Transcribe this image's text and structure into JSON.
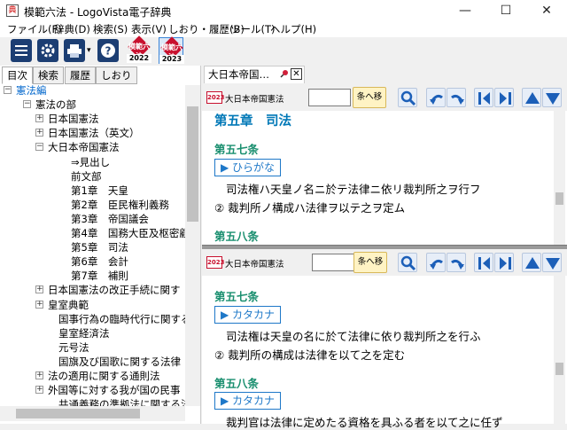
{
  "window": {
    "title": "模範六法 - LogoVista電子辞典",
    "app_icon_glyph": "典",
    "minimize_glyph": "—",
    "maximize_glyph": "☐",
    "close_glyph": "✕"
  },
  "menu": [
    "ファイル(F)",
    "辞典(D)",
    "検索(S)",
    "表示(V)",
    "しおり・履歴(B)",
    "ツール(T)",
    "ヘルプ(H)"
  ],
  "toolbar": {
    "books": [
      {
        "label": "模範六法",
        "year": "2022"
      },
      {
        "label": "模範六法",
        "year": "2023"
      }
    ],
    "dropdown_glyph": "▾"
  },
  "left_tabs": [
    "目次",
    "検索",
    "履歴",
    "しおり"
  ],
  "tree": [
    {
      "label": "憲法編",
      "exp": "⊟",
      "sel": true
    },
    {
      "label": "憲法の部",
      "exp": "⊟"
    },
    {
      "label": "日本国憲法",
      "exp": "⊞"
    },
    {
      "label": "日本国憲法（英文）",
      "exp": "⊞"
    },
    {
      "label": "大日本帝国憲法",
      "exp": "⊟"
    },
    {
      "label": "⇒見出し"
    },
    {
      "label": "前文部"
    },
    {
      "label": "第1章　天皇"
    },
    {
      "label": "第2章　臣民権利義務"
    },
    {
      "label": "第3章　帝国議会"
    },
    {
      "label": "第4章　国務大臣及枢密顧"
    },
    {
      "label": "第5章　司法"
    },
    {
      "label": "第6章　会計"
    },
    {
      "label": "第7章　補則"
    },
    {
      "label": "日本国憲法の改正手続に関す",
      "exp": "⊞"
    },
    {
      "label": "皇室典範",
      "exp": "⊞"
    },
    {
      "label": "国事行為の臨時代行に関する"
    },
    {
      "label": "皇室経済法"
    },
    {
      "label": "元号法"
    },
    {
      "label": "国旗及び国歌に関する法律"
    },
    {
      "label": "法の適用に関する通則法",
      "exp": "⊞"
    },
    {
      "label": "外国等に対する我が国の民事",
      "exp": "⊞"
    },
    {
      "label": "共通義務の準拠法に関する法"
    }
  ],
  "doc_tab": {
    "label": "大日本帝国…"
  },
  "dict_bar": {
    "logo": "2023",
    "name": "大日本帝国憲法",
    "go_label": "条へ移動",
    "search_value": ""
  },
  "top_pane": {
    "chapter": "第五章　司法",
    "article1": "第五七条",
    "kana_btn": "▶ ひらがな",
    "line1": "司法権ハ天皇ノ名ニ於テ法律ニ依リ裁判所之ヲ行フ",
    "line2": "②  裁判所ノ構成ハ法律ヲ以テ之ヲ定ム",
    "article2": "第五八条"
  },
  "bottom_pane": {
    "article1": "第五七条",
    "kana_btn": "▶ カタカナ",
    "line1": "司法権は天皇の名に於て法律に依り裁判所之を行ふ",
    "line2": "②  裁判所の構成は法律を以て之を定む",
    "article2": "第五八条",
    "kana_btn2": "▶ カタカナ",
    "line3": "裁判官は法律に定めたる資格を具ふる者を以て之に任ず"
  }
}
